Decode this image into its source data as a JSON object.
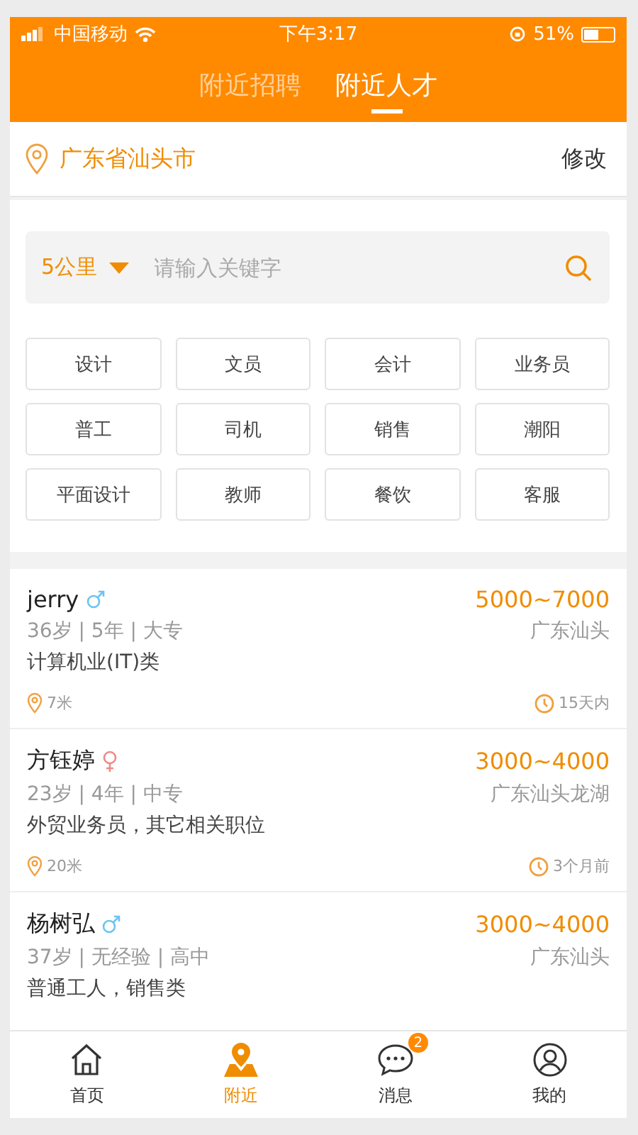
{
  "status_bar": {
    "carrier": "中国移动",
    "time": "下午3:17",
    "battery": "51%"
  },
  "header_tabs": [
    {
      "label": "附近招聘",
      "selected": false
    },
    {
      "label": "附近人才",
      "selected": true
    }
  ],
  "location": {
    "city": "广东省汕头市",
    "action": "修改"
  },
  "search": {
    "distance": "5公里",
    "placeholder": "请输入关键字"
  },
  "tags": [
    "设计",
    "文员",
    "会计",
    "业务员",
    "普工",
    "司机",
    "销售",
    "潮阳",
    "平面设计",
    "教师",
    "餐饮",
    "客服"
  ],
  "people": [
    {
      "name": "jerry",
      "kind": "male",
      "meta": "36岁 | 5年 | 大专",
      "category": "计算机业(IT)类",
      "distance": "7米",
      "time": "15天内",
      "salary": "5000~7000",
      "place": "广东汕头"
    },
    {
      "name": "方钰婷",
      "kind": "female",
      "meta": "23岁 | 4年 | 中专",
      "category": "外贸业务员，其它相关职位",
      "distance": "20米",
      "time": "3个月前",
      "salary": "3000~4000",
      "place": "广东汕头龙湖"
    },
    {
      "name": "杨树弘",
      "kind": "male",
      "meta": "37岁 | 无经验 | 高中",
      "category": "普通工人，销售类",
      "salary": "3000~4000",
      "place": "广东汕头"
    }
  ],
  "bottom_nav": [
    {
      "kind": "home",
      "label": "首页",
      "selected": false
    },
    {
      "kind": "nearby",
      "label": "附近",
      "selected": true
    },
    {
      "kind": "messages",
      "label": "消息",
      "selected": false,
      "badge": "2"
    },
    {
      "kind": "profile",
      "label": "我的",
      "selected": false
    }
  ]
}
